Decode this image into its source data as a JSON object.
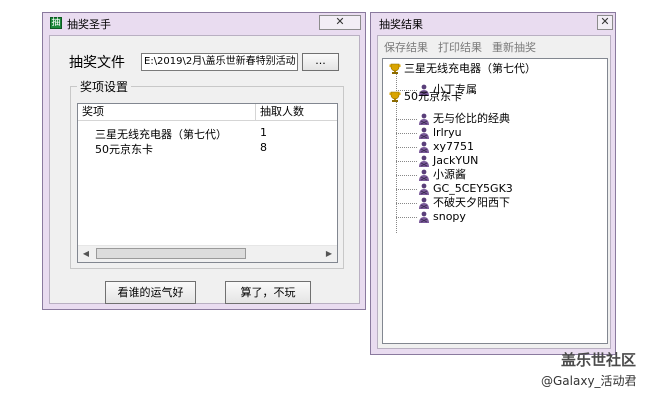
{
  "main_window": {
    "title": "抽奖圣手",
    "file_label": "抽奖文件",
    "file_path": "E:\\2019\\2月\\盖乐世新春特别活动",
    "browse_label": "...",
    "group_title": "奖项设置",
    "columns": [
      "奖项",
      "抽取人数"
    ],
    "rows": [
      {
        "prize": "三星无线充电器（第七代）",
        "count": "1"
      },
      {
        "prize": "50元京东卡",
        "count": "8"
      }
    ],
    "lucky_button": "看谁的运气好",
    "cancel_button": "算了，不玩"
  },
  "result_window": {
    "title": "抽奖结果",
    "menu": [
      "保存结果",
      "打印结果",
      "重新抽奖"
    ],
    "prizes": [
      {
        "name": "三星无线充电器（第七代）",
        "winners": [
          "小丁专属"
        ]
      },
      {
        "name": "50元京东卡",
        "winners": [
          "无与伦比的经典",
          "lrlryu",
          "xy7751",
          "JackYUN",
          "小源酱",
          "GC_5CEY5GK3",
          "不破天夕阳西下",
          "snopy"
        ]
      }
    ]
  },
  "watermark": {
    "brand": "盖乐世社区",
    "handle": "@Galaxy_活动君"
  },
  "icons": {
    "close": "close-icon",
    "trophy": "trophy-icon",
    "winner": "person-icon"
  },
  "colors": {
    "window_frame": "#e9dcf0",
    "trophy_gold": "#d9a400",
    "watermark_brand": "#4a4a4a"
  }
}
